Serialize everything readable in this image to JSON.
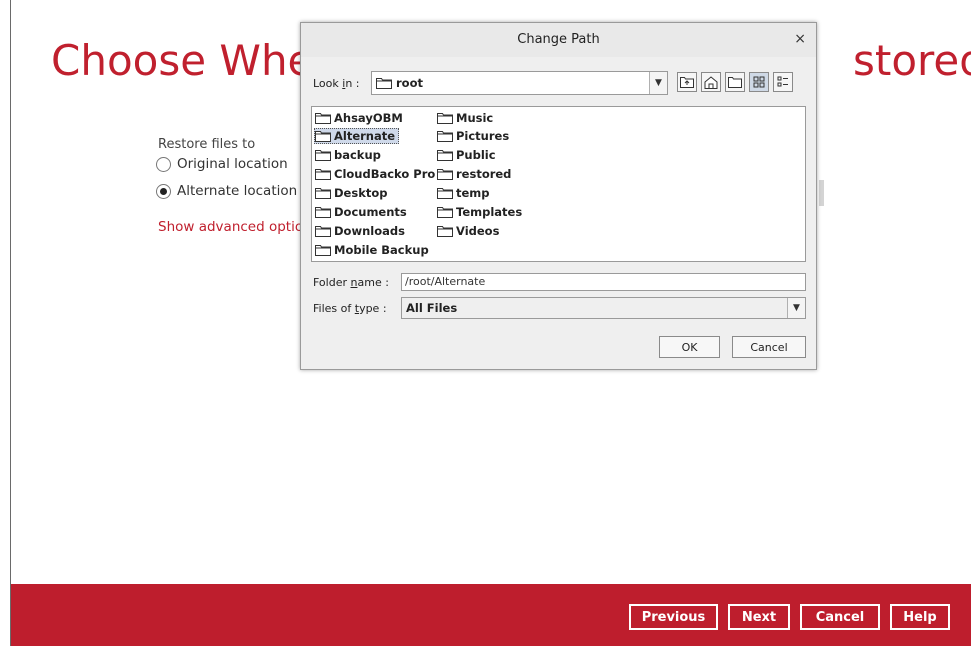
{
  "page": {
    "heading_left": "Choose Whe",
    "heading_right": "stored",
    "restore_files_to": "Restore files to",
    "options": {
      "original": "Original location",
      "alternate": "Alternate location"
    },
    "selected_option": "alternate",
    "advanced_link": "Show advanced optio"
  },
  "footer": {
    "previous": "Previous",
    "next": "Next",
    "cancel": "Cancel",
    "help": "Help"
  },
  "dialog": {
    "title": "Change Path",
    "close_glyph": "×",
    "look_in_label_pre": "Look ",
    "look_in_label_u": "i",
    "look_in_label_post": "n :",
    "look_in_value": "root",
    "files": [
      "AhsayOBM",
      "Alternate",
      "backup",
      "CloudBacko Pro",
      "Desktop",
      "Documents",
      "Downloads",
      "Mobile Backup",
      "Music",
      "Pictures",
      "Public",
      "restored",
      "temp",
      "Templates",
      "Videos"
    ],
    "selected_file": "Alternate",
    "folder_name_label_pre": "Folder ",
    "folder_name_label_u": "n",
    "folder_name_label_post": "ame :",
    "folder_name_value": "/root/Alternate",
    "files_of_type_label_pre": "Files of ",
    "files_of_type_label_u": "t",
    "files_of_type_label_post": "ype :",
    "files_of_type_value": "All Files",
    "ok": "OK",
    "cancel": "Cancel"
  },
  "colors": {
    "brand_red": "#be1e2d",
    "selection": "#cfd9ea"
  },
  "icons": [
    "folder-icon",
    "up-folder-icon",
    "home-icon",
    "new-folder-icon",
    "list-view-icon",
    "details-view-icon",
    "close-icon",
    "dropdown-arrow-icon"
  ]
}
